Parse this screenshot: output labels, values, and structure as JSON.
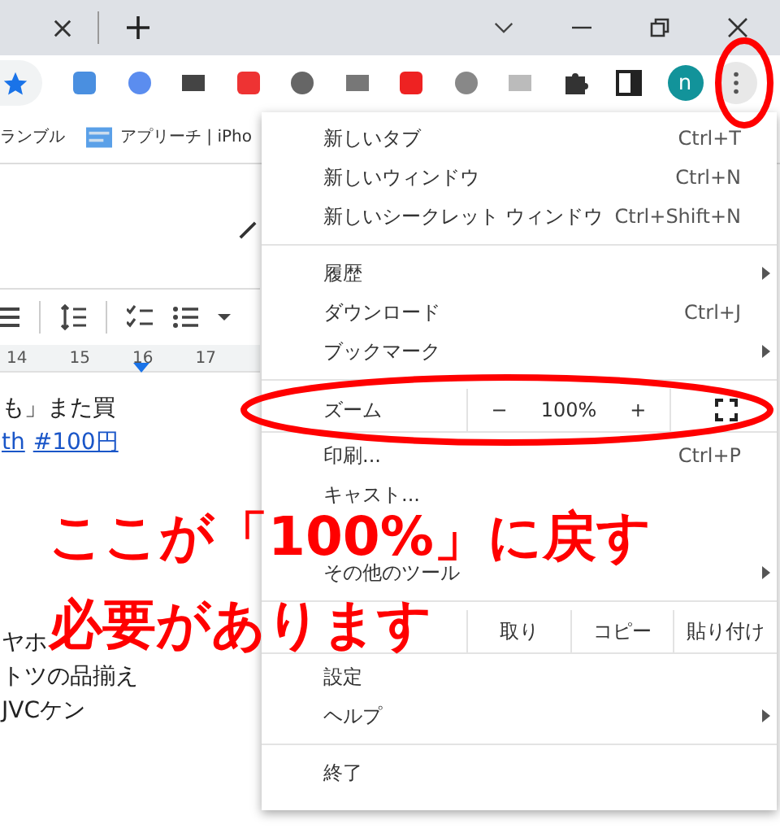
{
  "profile": {
    "initial": "n"
  },
  "bookmarks": [
    {
      "label": "ランブル",
      "has_icon": false
    },
    {
      "label": "アプリーチ | iPho",
      "has_icon": true
    }
  ],
  "document": {
    "ruler": [
      "14",
      "15",
      "16",
      "17"
    ],
    "lines": [
      {
        "kind": "text",
        "text": "も」また買"
      },
      {
        "kind": "links",
        "parts": [
          "th",
          "#100円"
        ]
      },
      {
        "kind": "gap"
      },
      {
        "kind": "text",
        "text": "ヤホ"
      },
      {
        "kind": "text",
        "text": "トツの品揃え"
      },
      {
        "kind": "text",
        "text": "JVCケン"
      }
    ]
  },
  "menu": [
    {
      "kind": "item",
      "label": "新しいタブ",
      "shortcut": "Ctrl+T",
      "has_submenu": false
    },
    {
      "kind": "item",
      "label": "新しいウィンドウ",
      "shortcut": "Ctrl+N",
      "has_submenu": false
    },
    {
      "kind": "item",
      "label": "新しいシークレット ウィンドウ",
      "shortcut": "Ctrl+Shift+N",
      "has_submenu": false
    },
    {
      "kind": "divider"
    },
    {
      "kind": "item",
      "label": "履歴",
      "has_submenu": true
    },
    {
      "kind": "item",
      "label": "ダウンロード",
      "shortcut": "Ctrl+J",
      "has_submenu": false
    },
    {
      "kind": "item",
      "label": "ブックマーク",
      "has_submenu": true
    },
    {
      "kind": "divider"
    },
    {
      "kind": "zoom",
      "label": "ズーム",
      "minus": "−",
      "value": "100%",
      "plus": "+"
    },
    {
      "kind": "item",
      "label": "印刷...",
      "shortcut": "Ctrl+P",
      "has_submenu": false
    },
    {
      "kind": "item",
      "label": "キャスト...",
      "has_submenu": false
    },
    {
      "kind": "covered"
    },
    {
      "kind": "item",
      "label": "その他のツール",
      "has_submenu": true
    },
    {
      "kind": "divider"
    },
    {
      "kind": "edit",
      "buttons": [
        "取り",
        "コピー",
        "貼り付け"
      ]
    },
    {
      "kind": "item",
      "label": "設定",
      "has_submenu": false
    },
    {
      "kind": "item",
      "label": "ヘルプ",
      "has_submenu": true
    },
    {
      "kind": "divider"
    },
    {
      "kind": "item",
      "label": "終了",
      "has_submenu": false
    }
  ],
  "annotation": {
    "lines": [
      "ここが「100%」に戻す",
      "必要があります"
    ]
  }
}
